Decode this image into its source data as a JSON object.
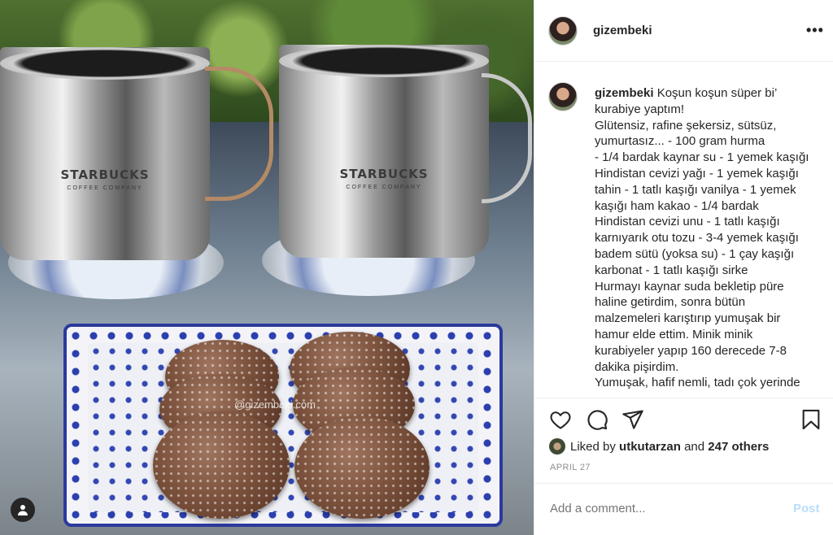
{
  "post": {
    "username": "gizembeki",
    "more_label": "•••",
    "caption": {
      "username": "gizembeki",
      "lines": [
        "Koşun koşun süper bi’",
        "kurabiye yaptım!",
        "Glütensiz, rafine şekersiz, sütsüz,",
        "yumurtasız... - 100 gram hurma",
        "- 1/4 bardak kaynar su - 1 yemek kaşığı",
        "Hindistan cevizi yağı - 1 yemek kaşığı",
        "tahin - 1 tatlı kaşığı vanilya - 1 yemek",
        "kaşığı ham kakao - 1/4 bardak",
        "Hindistan cevizi unu - 1 tatlı kaşığı",
        "karnıyarık otu tozu - 3-4 yemek kaşığı",
        "badem sütü (yoksa su) - 1 çay kaşığı",
        "karbonat - 1 tatlı kaşığı sirke",
        "Hurmayı kaynar suda bekletip püre",
        "haline getirdim, sonra bütün",
        "malzemeleri karıştırıp yumuşak bir",
        "hamur elde ettim. Minik minik",
        "kurabiyeler yapıp 160 derecede 7-8",
        "dakika pişirdim.",
        "Yumuşak, hafif nemli, tadı çok yerinde"
      ]
    },
    "likes": {
      "prefix": "Liked by",
      "user": "utkutarzan",
      "and": "and",
      "others": "247 others"
    },
    "date": "APRIL 27",
    "comment": {
      "placeholder": "Add a comment...",
      "post_label": "Post"
    },
    "photo": {
      "watermark": "@gizembeki.com",
      "mug_brand": "STARBUCKS",
      "mug_sub": "COFFEE COMPANY"
    }
  },
  "icons": {
    "like": "heart-icon",
    "comment": "comment-icon",
    "share": "share-icon",
    "save": "bookmark-icon",
    "more": "more-icon",
    "user_tag": "user-tag-icon"
  },
  "colors": {
    "text": "#262626",
    "muted": "#8e8e8e",
    "post_disabled": "#b9dffc",
    "border": "#efefef"
  }
}
